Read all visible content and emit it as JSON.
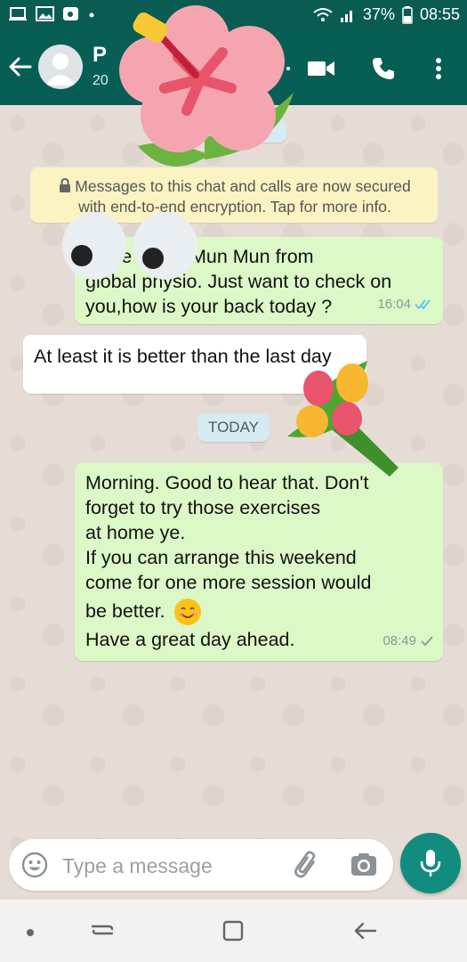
{
  "status_bar": {
    "battery": "37%",
    "time": "08:55"
  },
  "header": {
    "contact_name": "P",
    "contact_subtitle": "20"
  },
  "chat": {
    "date_chip_top": "",
    "encryption_notice": "Messages to this chat and calls are now secured with end-to-end encryption. Tap for more info.",
    "messages": [
      {
        "direction": "out",
        "text_line1": "Hie . I am Mun Mun from",
        "text_line2": "global physio. Just want to check on",
        "text_line3": "you,how is your back today ?",
        "time": "16:04",
        "status": "read"
      },
      {
        "direction": "in",
        "text": "At least it is better than the last day"
      },
      {
        "direction": "out",
        "line1": "Morning. Good to hear that. Don't",
        "line2": "forget to try those exercises",
        "line3": "at home ye.",
        "line4": "If you can arrange this weekend",
        "line5": "come for one more session would",
        "line6": "be better.",
        "line7": "Have a great day ahead.",
        "time": "08:49",
        "status": "sent"
      }
    ],
    "date_chip_today": "TODAY"
  },
  "input": {
    "placeholder": "Type a message"
  },
  "colors": {
    "header": "#075e54",
    "outgoing_bubble": "#dcf8c6",
    "incoming_bubble": "#ffffff",
    "mic_button": "#128c7e",
    "read_tick": "#4fc3f7"
  },
  "icons": [
    "back-arrow-icon",
    "avatar",
    "video-call-icon",
    "phone-icon",
    "more-vertical-icon",
    "lock-icon",
    "emoji-icon",
    "attach-icon",
    "camera-icon",
    "mic-icon"
  ]
}
